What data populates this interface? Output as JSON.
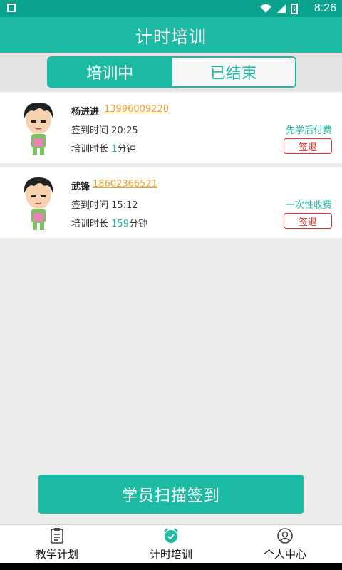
{
  "status_bar": {
    "time": "8:26",
    "icons": [
      "image-icon",
      "wifi-icon",
      "signal-icon",
      "battery-charging-icon"
    ]
  },
  "title": "计时培训",
  "tabs": [
    {
      "label": "培训中",
      "active": true
    },
    {
      "label": "已结束",
      "active": false
    }
  ],
  "records": [
    {
      "name": "杨进进",
      "phone": "13996009220",
      "checkin_label": "签到时间",
      "checkin_time": "20:25",
      "duration_label": "培训时长",
      "duration_value": "1",
      "duration_unit": "分钟",
      "pay_type": "先学后付费",
      "signout_label": "签退"
    },
    {
      "name": "武锋",
      "phone": "18602366521",
      "checkin_label": "签到时间",
      "checkin_time": "15:12",
      "duration_label": "培训时长",
      "duration_value": "159",
      "duration_unit": "分钟",
      "pay_type": "一次性收费",
      "signout_label": "签退"
    }
  ],
  "scan_button_label": "学员扫描签到",
  "bottom_nav": [
    {
      "label": "教学计划",
      "icon": "clipboard-icon"
    },
    {
      "label": "计时培训",
      "icon": "alarm-clock-icon",
      "active": true
    },
    {
      "label": "个人中心",
      "icon": "user-circle-icon"
    }
  ],
  "colors": {
    "primary": "#1dbba3",
    "statusbar": "#0aa38e",
    "phone_link": "#f0a22a",
    "danger": "#e5322f"
  }
}
